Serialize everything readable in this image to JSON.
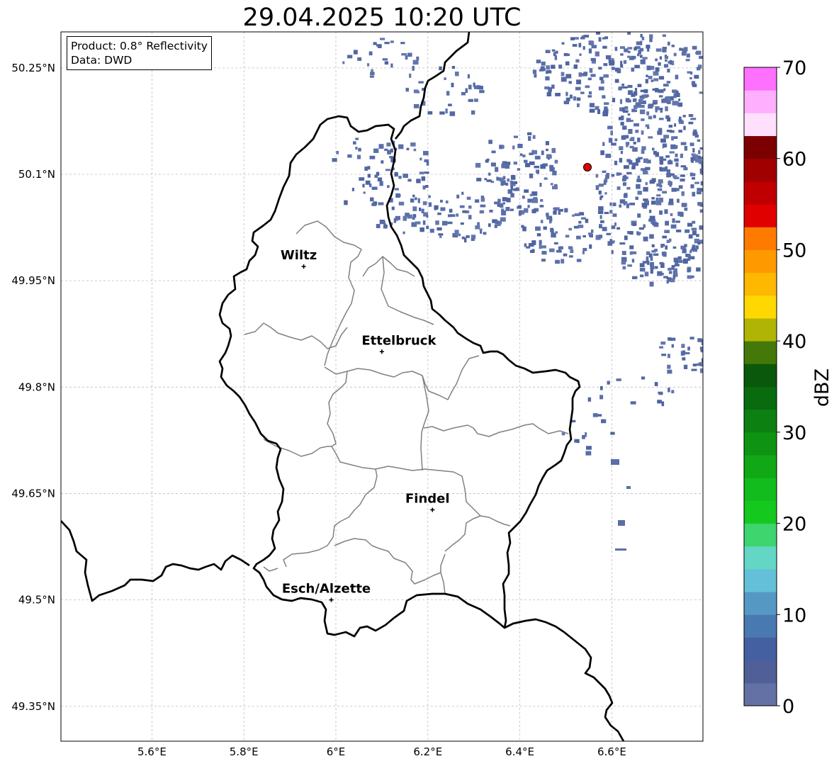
{
  "title": "29.04.2025 10:20 UTC",
  "info": {
    "product": "Product: 0.8° Reflectivity",
    "data_source": "Data: DWD"
  },
  "map": {
    "lon_ticks": [
      "5.6°E",
      "5.8°E",
      "6°E",
      "6.2°E",
      "6.4°E",
      "6.6°E"
    ],
    "lat_ticks": [
      "50.25°N",
      "50.1°N",
      "49.95°N",
      "49.8°N",
      "49.65°N",
      "49.5°N",
      "49.35°N"
    ],
    "cities": [
      {
        "name": "Wiltz",
        "lon": 5.93,
        "lat": 49.97
      },
      {
        "name": "Ettelbruck",
        "lon": 6.1,
        "lat": 49.85
      },
      {
        "name": "Findel",
        "lon": 6.21,
        "lat": 49.627
      },
      {
        "name": "Esch/Alzette",
        "lon": 5.99,
        "lat": 49.5
      }
    ],
    "radar_site": {
      "lon": 6.548,
      "lat": 50.11
    }
  },
  "colorbar": {
    "label": "dBZ",
    "ticks": [
      "0",
      "10",
      "20",
      "30",
      "40",
      "50",
      "60",
      "70"
    ],
    "colors": [
      "#6471a4",
      "#505f98",
      "#4460a0",
      "#4a78b0",
      "#5698c4",
      "#63c0d8",
      "#64d6c6",
      "#3ed46e",
      "#14c81e",
      "#12bc1c",
      "#10a816",
      "#0e9412",
      "#0c8010",
      "#0a6a0e",
      "#0a580c",
      "#447808",
      "#b0b405",
      "#fed800",
      "#feb800",
      "#fe9a00",
      "#fe7a00",
      "#e00000",
      "#c00000",
      "#a00000",
      "#7c0000",
      "#fee0fe",
      "#feb0fe",
      "#fe70fe",
      "#ee36ee"
    ]
  }
}
